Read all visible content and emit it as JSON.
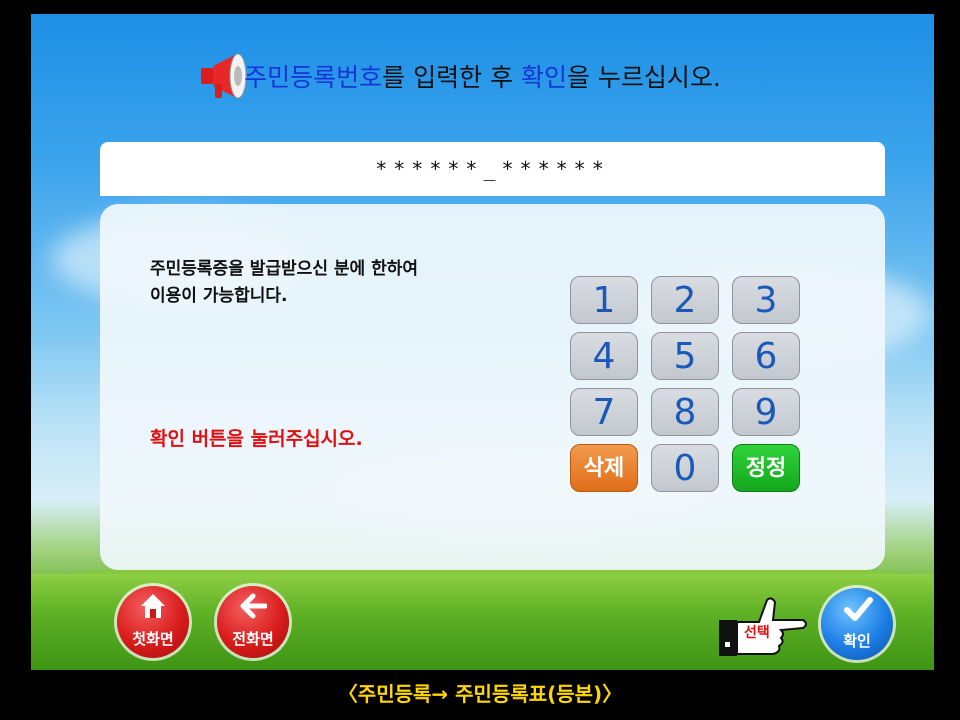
{
  "header": {
    "part1": "주민등록번호",
    "part2": "를 입력한 후 ",
    "part3": "확인",
    "part4": "을 누르십시오."
  },
  "input": {
    "masked_value": "******_******"
  },
  "panel": {
    "notice_line1": "주민등록증을 발급받으신 분에 한하여",
    "notice_line2": "이용이 가능합니다.",
    "instruction": "확인 버튼을 눌러주십시오."
  },
  "keypad": {
    "k1": "1",
    "k2": "2",
    "k3": "3",
    "k4": "4",
    "k5": "5",
    "k6": "6",
    "k7": "7",
    "k8": "8",
    "k9": "9",
    "delete": "삭제",
    "k0": "0",
    "correct": "정정"
  },
  "nav": {
    "home_label": "첫화면",
    "back_label": "전화면",
    "select_label": "선택",
    "confirm_label": "확인"
  },
  "footer": {
    "breadcrumb": "〈주민등록→ 주민등록표(등본)〉"
  },
  "colors": {
    "highlight_blue": "#1535d6",
    "alert_red": "#e01010",
    "footer_yellow": "#ffd700",
    "key_text": "#1a59b8"
  }
}
